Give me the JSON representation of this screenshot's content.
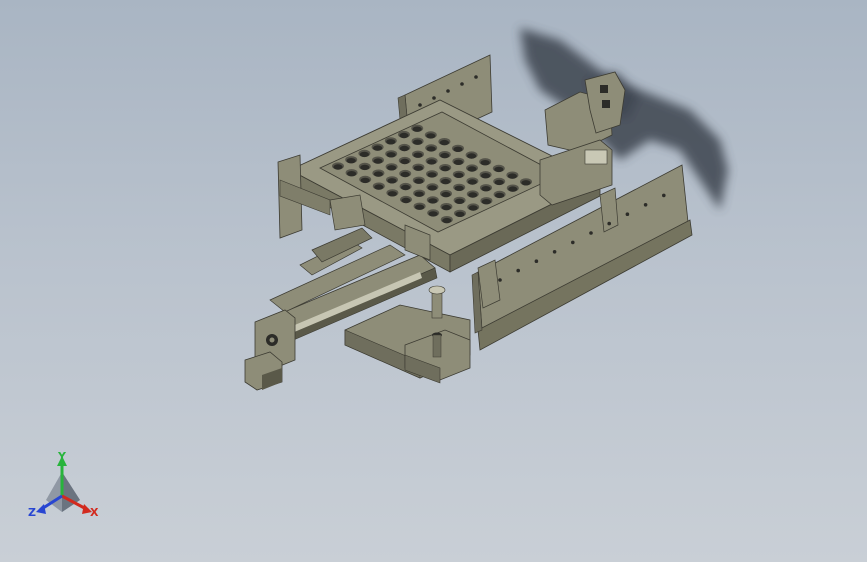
{
  "viewport": {
    "background_top": "#a9b5c3",
    "background_bottom": "#c9cfd6",
    "model_color": "#8e8d78",
    "model_shade": "#6f6e5d",
    "hole_color": "#2c2c28",
    "shadow_color": "#3e4450"
  },
  "triad": {
    "x_label": "X",
    "y_label": "Y",
    "z_label": "Z",
    "x_color": "#d22a1e",
    "y_color": "#28b43c",
    "z_color": "#2846d2"
  },
  "tray": {
    "rows": 7,
    "cols": 9
  }
}
